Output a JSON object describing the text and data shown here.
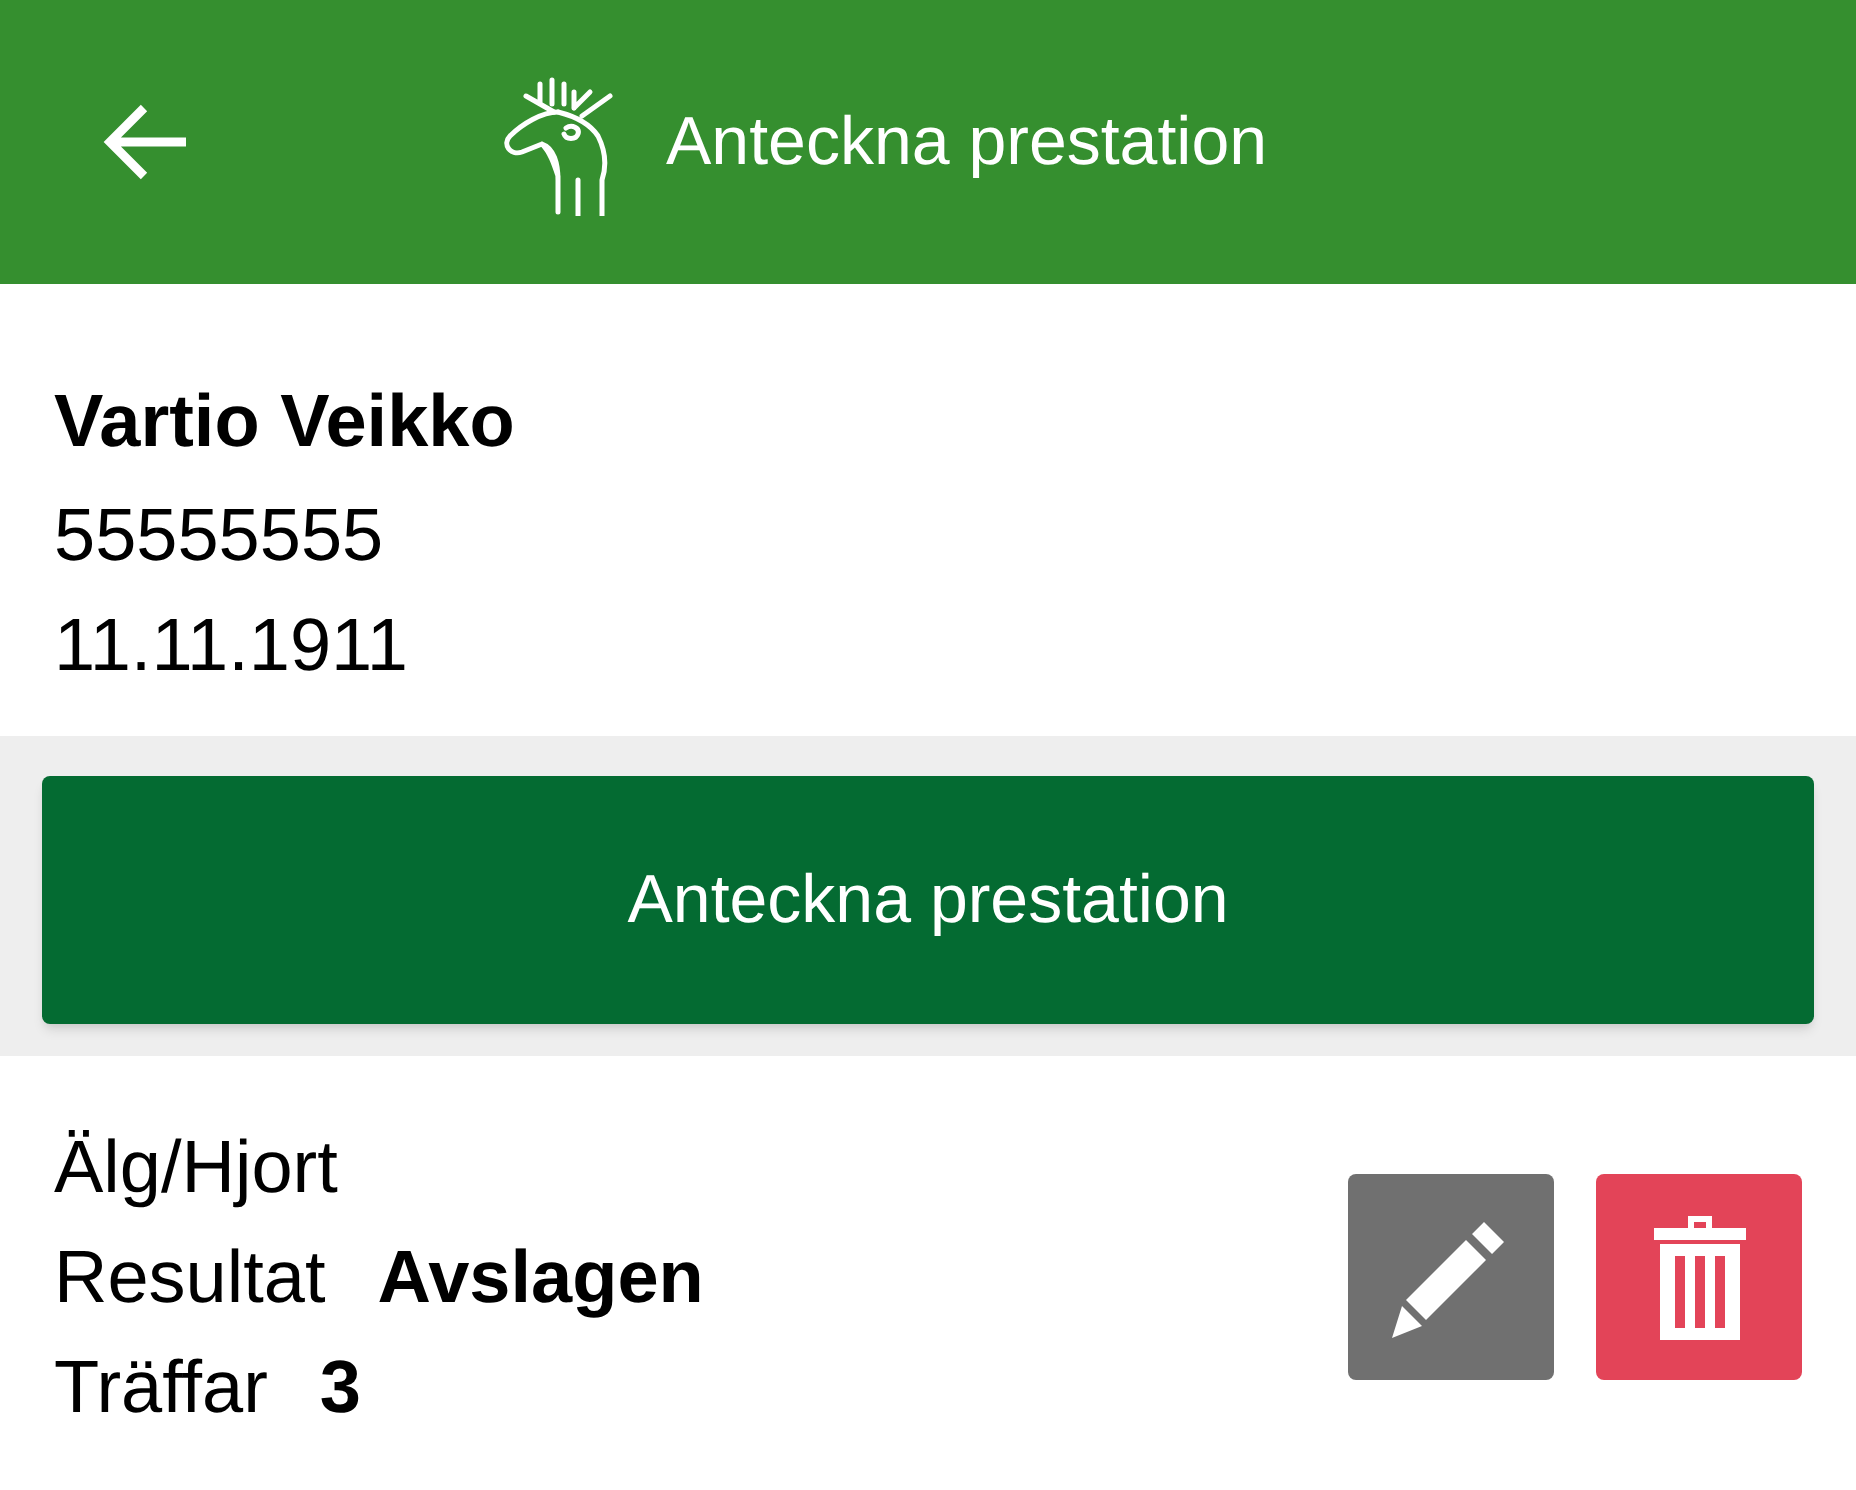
{
  "app_bar": {
    "title": "Anteckna prestation"
  },
  "person": {
    "name": "Vartio Veikko",
    "number": "55555555",
    "birth_date": "11.11.1911"
  },
  "primary_button": {
    "label": "Anteckna prestation"
  },
  "performances": [
    {
      "type": "Älg/Hjort",
      "result_label": "Resultat",
      "result": "Avslagen",
      "hits_label": "Träffar",
      "hits": "3"
    }
  ]
}
